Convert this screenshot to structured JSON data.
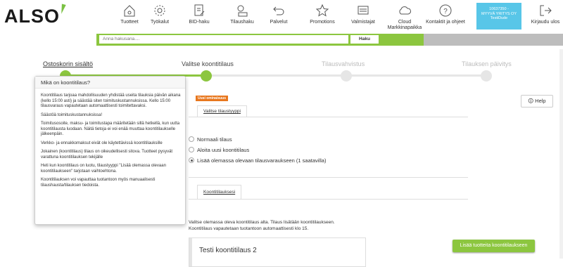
{
  "header": {
    "logo_text": "ALSO",
    "nav": [
      {
        "label": "Tuotteet",
        "icon": "home-icon"
      },
      {
        "label": "Työkalut",
        "icon": "gear-icon"
      },
      {
        "label": "BID-haku",
        "icon": "document-edit-icon"
      },
      {
        "label": "Tilaushaku",
        "icon": "tracking-icon"
      },
      {
        "label": "Palvelut",
        "icon": "return-arrow-icon"
      },
      {
        "label": "Promotions",
        "icon": "star-icon"
      },
      {
        "label": "Valmistajat",
        "icon": "monitor-icon"
      },
      {
        "label": "Cloud Markkinapaikka",
        "icon": "cloud-icon"
      },
      {
        "label": "Kontaktit ja ohjeet",
        "icon": "help-circle-icon"
      }
    ],
    "user": {
      "line1": "10637350 -",
      "line2": "MYYVÄ YRITYS OY",
      "line3": "TestiDude"
    },
    "logout_label": "Kirjaudu ulos"
  },
  "search": {
    "placeholder": "Anna hakusana....",
    "button_label": "Haku"
  },
  "steps": [
    {
      "label": "Ostoskorin sisältö"
    },
    {
      "label": "Valitse koontitilaus"
    },
    {
      "label": "Tilausvahvistus"
    },
    {
      "label": "Tilauksen päivitys"
    }
  ],
  "main": {
    "new_badge": "Uusi ominaisuus",
    "tab_order_type": "Valitse tilaustyyppi",
    "radio_options": [
      {
        "label": "Normaali tilaus",
        "selected": false
      },
      {
        "label": "Aloita uusi koontitilaus",
        "selected": false
      },
      {
        "label": "Lisää olemassa olevaan tilausvaraukseen (1 saatavilla)",
        "selected": true
      }
    ],
    "help_label": "Help",
    "tab_orders": "Koontitilauksesi",
    "info_line1": "Valitse olemassa oleva koontitilaus alta. Tilaus lisätään koontitilaukseen.",
    "info_line2": "Koontitilaus vapautetaan tuotantoon automaattisesti klo 15.",
    "order_title": "Testi koontitilaus 2",
    "add_button": "Lisää tuotteita koontitilaukseen"
  },
  "popover": {
    "title": "Mikä on koontitilaus?",
    "paragraphs": [
      "Koontitilaus tarjoaa mahdollisuuden yhdistää useita tilauksia päivän aikana (kello 15:00 asti) ja säästää siten toimituskustannuksissa. Kello 15:00 tilausvaraus vapautetaan automaattisesti toimitettavaksi.",
      "Säästöä toimituskustannuksissa!",
      "Toimitusosoite, maksu- ja toimitustapa määritetään sillä hetkellä, kun uutta koontitilausta luodaan. Näitä tietoja ei voi enää muuttaa koontitilaukselle jälkeenpäin.",
      "Verkko- ja ennakkomaksut eivät ole käytettävissä koontitilauksille",
      "Jokainen (koontitilaus) tilaus on oikeudellisesti sitova. Tuotteet pysyvät varattuna koontitilauksen tekijälle",
      "Heti kun koontitilaus on luotu, tilaustyyppi \"Lisää olemassa olevaan koontitilaukseen\" tarjotaan vaihtoehtona.",
      "Koontitilauksen voi vapauttaa tuotantoon myös manuaalisesti tilaushausta/tilauksen tiedoista."
    ]
  },
  "colors": {
    "brand_green": "#8cc63f",
    "user_blue": "#58c6e8",
    "badge_orange": "#e8771e"
  }
}
